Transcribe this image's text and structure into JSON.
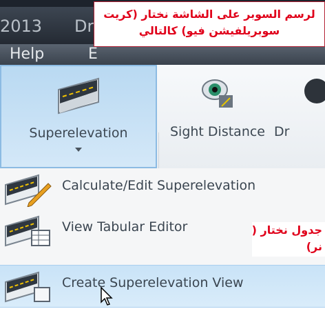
{
  "window": {
    "year_fragment": "2013",
    "tab_fragment": "Drav"
  },
  "menubar": {
    "help_label": "Help",
    "next_label_fragment": "E"
  },
  "ribbon": {
    "buttons": [
      {
        "label": "Superelevation",
        "icon": "road-superelevation-icon",
        "active": true,
        "has_dropdown": true
      },
      {
        "label": "Sight Distance",
        "icon": "eye-icon",
        "active": false
      },
      {
        "label": "Dr",
        "icon": "partial-icon",
        "active": false
      }
    ]
  },
  "dropdown": {
    "items": [
      {
        "label": "Calculate/Edit Superelevation",
        "icon": "road-pencil-icon"
      },
      {
        "label": "View Tabular Editor",
        "icon": "road-table-icon"
      },
      {
        "label": "Create Superelevation View",
        "icon": "road-view-icon",
        "highlighted": true
      }
    ]
  },
  "annotations": {
    "top_line1": "لرسم السوبر على الشاشة نختار (كريت",
    "top_line2": "سوبريلفيشن فيو) كالتالي",
    "side_line1": "جدول نختار (فيو",
    "side_line2": "نر)"
  },
  "colors": {
    "annotation_text": "#e0001a",
    "ribbon_active": "#b9d9f2",
    "menu_highlight": "#c9e3f7"
  }
}
